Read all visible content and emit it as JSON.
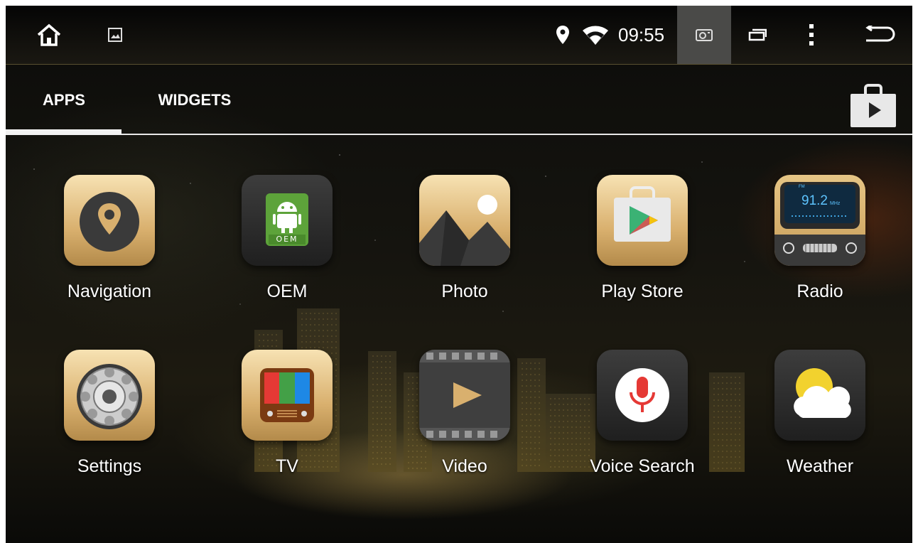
{
  "status_bar": {
    "time": "09:55",
    "icons": [
      "home-icon",
      "gallery-icon",
      "location-icon",
      "wifi-icon",
      "screenshot-icon",
      "recent-apps-icon",
      "overflow-menu-icon",
      "back-icon"
    ]
  },
  "tabs": [
    {
      "label": "APPS",
      "selected": true
    },
    {
      "label": "WIDGETS",
      "selected": false
    }
  ],
  "apps": [
    {
      "label": "Navigation",
      "icon": "navigation-icon"
    },
    {
      "label": "OEM",
      "icon": "oem-android-icon",
      "badge": "OEM"
    },
    {
      "label": "Photo",
      "icon": "photo-icon"
    },
    {
      "label": "Play Store",
      "icon": "play-store-icon"
    },
    {
      "label": "Radio",
      "icon": "radio-icon",
      "frequency": "91.2",
      "unit": "MHz",
      "band": "FM"
    },
    {
      "label": "Settings",
      "icon": "settings-gear-icon"
    },
    {
      "label": "TV",
      "icon": "tv-icon"
    },
    {
      "label": "Video",
      "icon": "video-icon"
    },
    {
      "label": "Voice Search",
      "icon": "microphone-icon"
    },
    {
      "label": "Weather",
      "icon": "weather-icon"
    }
  ],
  "colors": {
    "accent_gold": "#d9b06e",
    "tab_indicator": "#f2f2f2"
  }
}
